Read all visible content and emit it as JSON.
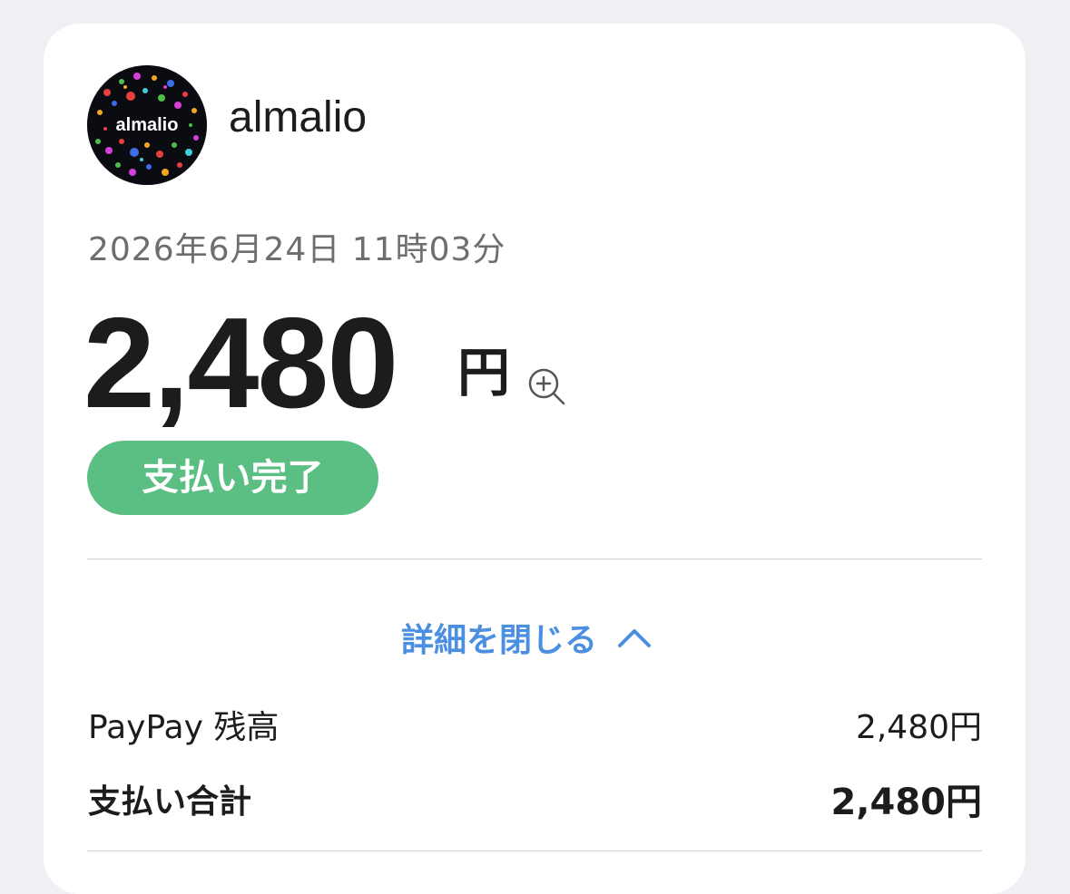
{
  "merchant": {
    "name": "almalio",
    "avatar_text": "almalio"
  },
  "payment": {
    "datetime": "2026年6月24日 11時03分",
    "amount": "2,480",
    "currency": "円",
    "status": "支払い完了"
  },
  "details": {
    "toggle_label": "詳細を閉じる",
    "rows": [
      {
        "label": "PayPay 残高",
        "value": "2,480円"
      },
      {
        "label": "支払い合計",
        "value": "2,480円"
      }
    ]
  },
  "colors": {
    "background": "#eff0f4",
    "status_green": "#5bbe82",
    "link_blue": "#4a8fe0"
  },
  "icons": {
    "zoom": "zoom-in-icon",
    "toggle": "chevron-up-icon"
  }
}
